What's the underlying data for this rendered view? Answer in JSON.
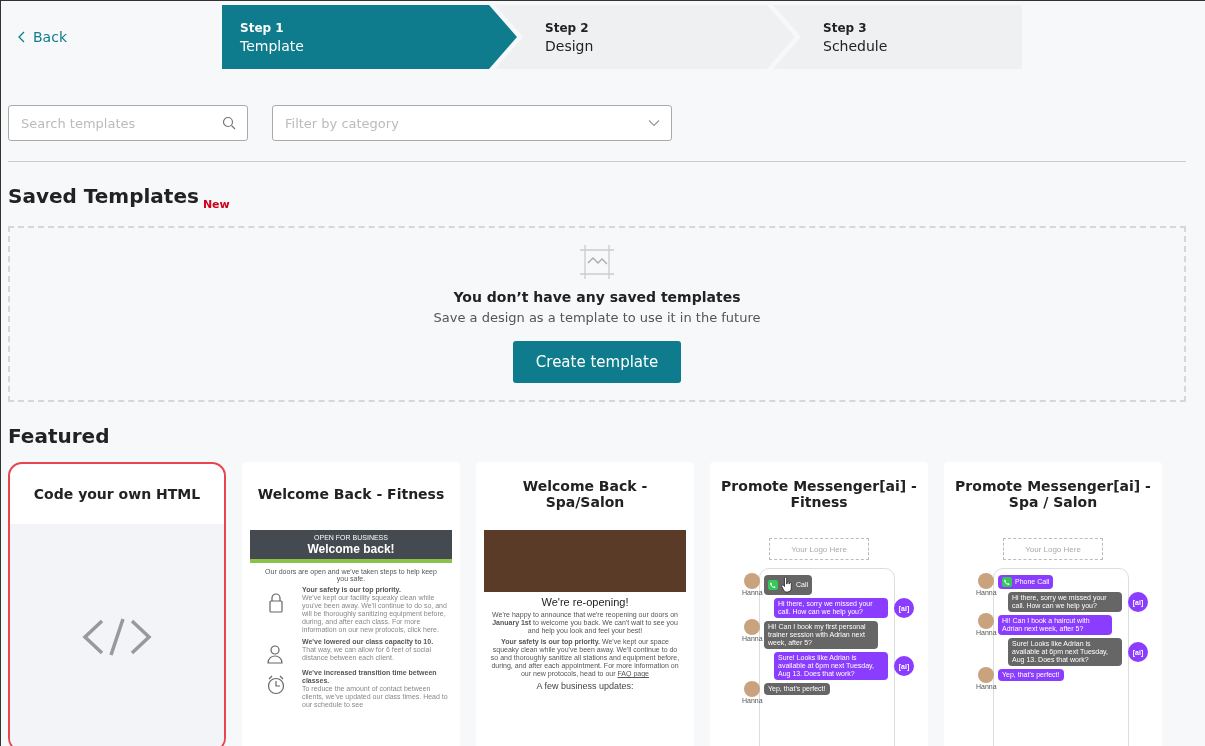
{
  "back": {
    "label": "Back"
  },
  "steps": [
    {
      "number": "Step 1",
      "label": "Template",
      "selected": true
    },
    {
      "number": "Step 2",
      "label": "Design",
      "selected": false
    },
    {
      "number": "Step 3",
      "label": "Schedule",
      "selected": false
    }
  ],
  "search": {
    "placeholder": "Search templates"
  },
  "filter": {
    "placeholder": "Filter by category"
  },
  "saved": {
    "title": "Saved Templates",
    "badge": "New",
    "empty_title": "You don’t have any saved templates",
    "empty_text": "Save a design as a template to use it in the future",
    "button": "Create template"
  },
  "featured": {
    "title": "Featured",
    "cards": [
      {
        "kind": "code",
        "title": "Code your own HTML",
        "selected": true
      },
      {
        "kind": "fitness",
        "title": "Welcome Back - Fitness",
        "selected": false,
        "preview": {
          "kicker": "OPEN FOR BUSINESS",
          "heading": "Welcome back!",
          "intro": "Our doors are open and we've taken steps to help keep you safe.",
          "features": [
            {
              "kind": "lock",
              "title": "Your safety is our top priority.",
              "body": "We've kept our facility squeaky clean while you've been away. We'll continue to do so, and will be thoroughly sanitizing equipment before, during, and after each class. For more information on our new protocols, click here."
            },
            {
              "kind": "people",
              "title": "We've lowered our class capacity to 10.",
              "body": "That way, we can allow for 6 feet of social distance between each client."
            },
            {
              "kind": "clock",
              "title": "We've increased transition time between classes.",
              "body": "To reduce the amount of contact between clients, we've updated our class times. Head to our schedule to see"
            }
          ]
        }
      },
      {
        "kind": "spa",
        "title": "Welcome Back - Spa/Salon",
        "selected": false,
        "preview": {
          "heading": "We're re-opening!",
          "paragraphs": [
            "We're happy to announce that we're reopening our doors on **January 1st** to welcome you back. We can't wait to see you and help you look and feel your best!",
            "**Your safety is our top priority.** We've kept our space squeaky clean while you've been away. We'll continue to do so and thoroughly sanitize all stations and equipment before, during, and after each appointment. For more information on our new protocols, head to our"
          ],
          "link": "FAQ page",
          "subheading": "A few business updates:"
        }
      },
      {
        "kind": "chat",
        "title": "Promote Messenger[ai] - Fitness",
        "selected": false,
        "preview": {
          "logo": "Your Logo Here",
          "messages": [
            {
              "kind": "user",
              "name": "Hanna",
              "text": "Call",
              "call": true,
              "pointer": true,
              "color": "#666666"
            },
            {
              "kind": "ai",
              "badge": "[ai]",
              "text": "Hi there, sorry we missed your call. How can we help you?",
              "color": "#8b3dff"
            },
            {
              "kind": "user",
              "name": "Hanna",
              "text": "Hi! Can I book my first personal trainer session with Adrian next week, after 5?",
              "color": "#666666"
            },
            {
              "kind": "ai",
              "badge": "[ai]",
              "text": "Sure! Looks like Adrian is available at 6pm next Tuesday, Aug 13. Does that work?",
              "color": "#8b3dff"
            },
            {
              "kind": "user",
              "name": "Hanna",
              "text": "Yep, that's perfect!",
              "color": "#666666"
            }
          ]
        }
      },
      {
        "kind": "chat",
        "title": "Promote Messenger[ai] - Spa / Salon",
        "selected": false,
        "preview": {
          "logo": "Your Logo Here",
          "messages": [
            {
              "kind": "user",
              "name": "Hanna",
              "text": "Phone Call",
              "call": true,
              "color": "#8b3dff"
            },
            {
              "kind": "ai",
              "badge": "[ai]",
              "text": "Hi there, sorry we missed your call. How can we help you?",
              "color": "#666666"
            },
            {
              "kind": "user",
              "name": "Hanna",
              "text": "Hi! Can I book a haircut with Adrian next week, after 5?",
              "color": "#8b3dff"
            },
            {
              "kind": "ai",
              "badge": "[ai]",
              "text": "Sure! Looks like Adrian is available at 6pm next Tuesday, Aug 13. Does that work?",
              "color": "#666666"
            },
            {
              "kind": "user",
              "name": "Hanna",
              "text": "Yep, that's perfect!",
              "color": "#8b3dff"
            }
          ]
        }
      }
    ]
  }
}
